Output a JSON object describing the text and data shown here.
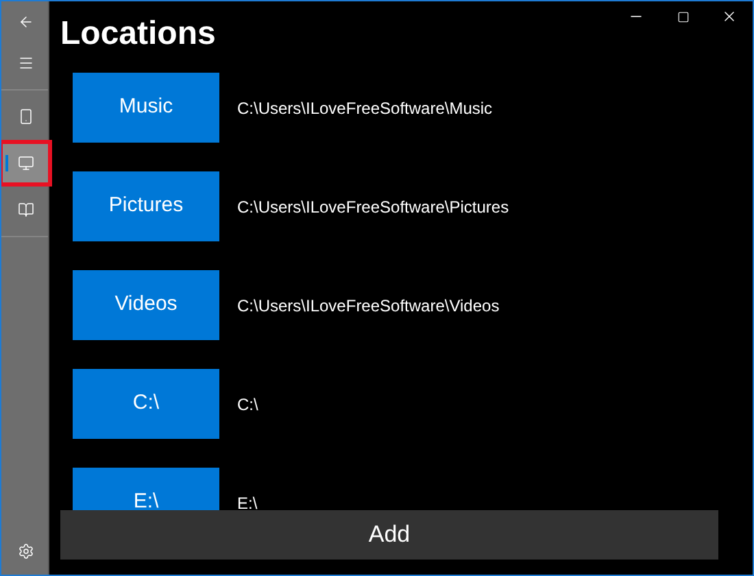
{
  "window": {
    "controls": [
      {
        "kind": "minimize"
      },
      {
        "kind": "maximize"
      },
      {
        "kind": "close"
      }
    ]
  },
  "sidebar": {
    "items": [
      {
        "kind": "back",
        "selected": false
      },
      {
        "kind": "menu",
        "selected": false
      },
      {
        "kind": "device",
        "selected": false
      },
      {
        "kind": "monitor",
        "selected": true,
        "highlighted": true
      },
      {
        "kind": "book",
        "selected": false
      }
    ],
    "footer": {
      "kind": "settings"
    }
  },
  "title": "Locations",
  "locations": [
    {
      "name": "Music",
      "path": "C:\\Users\\ILoveFreeSoftware\\Music"
    },
    {
      "name": "Pictures",
      "path": "C:\\Users\\ILoveFreeSoftware\\Pictures"
    },
    {
      "name": "Videos",
      "path": "C:\\Users\\ILoveFreeSoftware\\Videos"
    },
    {
      "name": "C:\\",
      "path": "C:\\"
    },
    {
      "name": "E:\\",
      "path": "E:\\"
    }
  ],
  "add_button": "Add"
}
